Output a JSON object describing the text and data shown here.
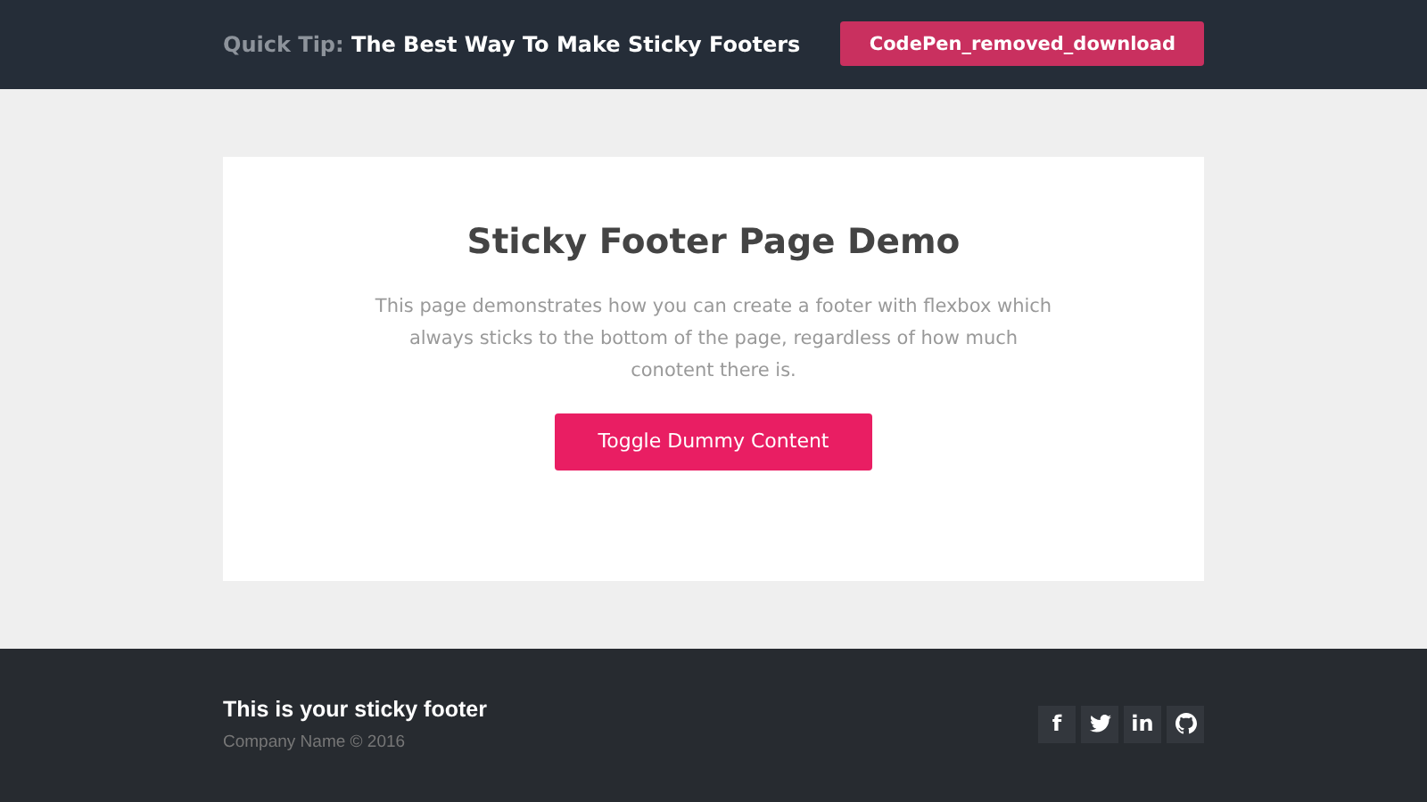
{
  "header": {
    "tip_label": "Quick Tip:",
    "tip_title": "The Best Way To Make Sticky Footers",
    "button": "CodePen_removed_download"
  },
  "card": {
    "title": "Sticky Footer Page Demo",
    "text": "This page demonstrates how you can create a footer with flexbox which always sticks to the bottom of the page, regardless of how much conotent there is.",
    "button": "Toggle Dummy Content"
  },
  "footer": {
    "title": "This is your sticky footer",
    "copyright": "Company Name © 2016",
    "social": [
      {
        "kind": "glyph",
        "label": "f"
      },
      {
        "kind": "bird"
      },
      {
        "kind": "glyph",
        "label": "in"
      },
      {
        "kind": "cat"
      }
    ]
  }
}
